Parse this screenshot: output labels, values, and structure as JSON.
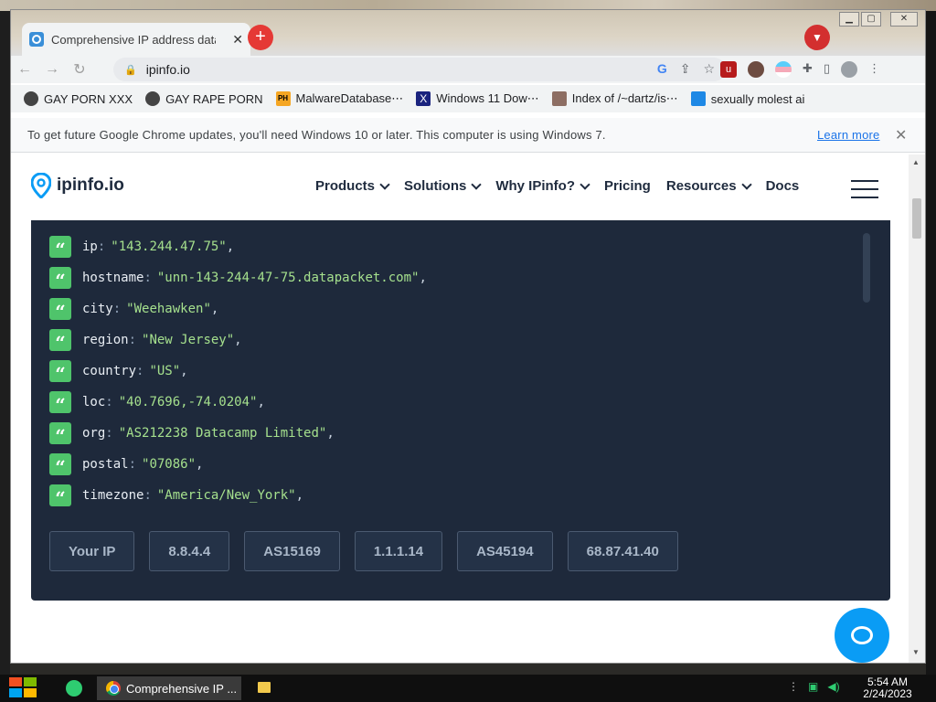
{
  "browser": {
    "tab_title": "Comprehensive IP address data",
    "url": "ipinfo.io",
    "bookmarks": [
      {
        "label": "GAY PORN XXX",
        "icon": "skull-icon"
      },
      {
        "label": "GAY RAPE PORN",
        "icon": "globe-icon"
      },
      {
        "label": "MalwareDatabase⋯",
        "icon": "ph-icon"
      },
      {
        "label": "Windows 11 Dow⋯",
        "icon": "x-icon"
      },
      {
        "label": "Index of /~dartz/is⋯",
        "icon": "index-icon"
      },
      {
        "label": "sexually molest ai",
        "icon": "doc-icon"
      }
    ],
    "infobar_text": "To get future Google Chrome updates, you'll need Windows 10 or later. This computer is using Windows 7.",
    "infobar_link": "Learn more"
  },
  "site": {
    "logo": "ipinfo.io",
    "nav": [
      {
        "label": "Products",
        "dropdown": true
      },
      {
        "label": "Solutions",
        "dropdown": true
      },
      {
        "label": "Why IPinfo?",
        "dropdown": true
      },
      {
        "label": "Pricing",
        "dropdown": false
      },
      {
        "label": "Resources",
        "dropdown": true
      },
      {
        "label": "Docs",
        "dropdown": false
      }
    ]
  },
  "ip_data": [
    {
      "key": "ip",
      "value": "\"143.244.47.75\""
    },
    {
      "key": "hostname",
      "value": "\"unn-143-244-47-75.datapacket.com\""
    },
    {
      "key": "city",
      "value": "\"Weehawken\""
    },
    {
      "key": "region",
      "value": "\"New Jersey\""
    },
    {
      "key": "country",
      "value": "\"US\""
    },
    {
      "key": "loc",
      "value": "\"40.7696,-74.0204\""
    },
    {
      "key": "org",
      "value": "\"AS212238 Datacamp Limited\""
    },
    {
      "key": "postal",
      "value": "\"07086\""
    },
    {
      "key": "timezone",
      "value": "\"America/New_York\""
    }
  ],
  "chips": [
    "Your IP",
    "8.8.4.4",
    "AS15169",
    "1.1.1.14",
    "AS45194",
    "68.87.41.40"
  ],
  "taskbar": {
    "chrome_label": "Comprehensive IP ...",
    "time": "5:54 AM",
    "date": "2/24/2023"
  },
  "colors": {
    "accent": "#0a9cf5",
    "code_bg": "#1e293b",
    "quote_badge": "#4fc46b",
    "code_value": "#a5e08d"
  }
}
